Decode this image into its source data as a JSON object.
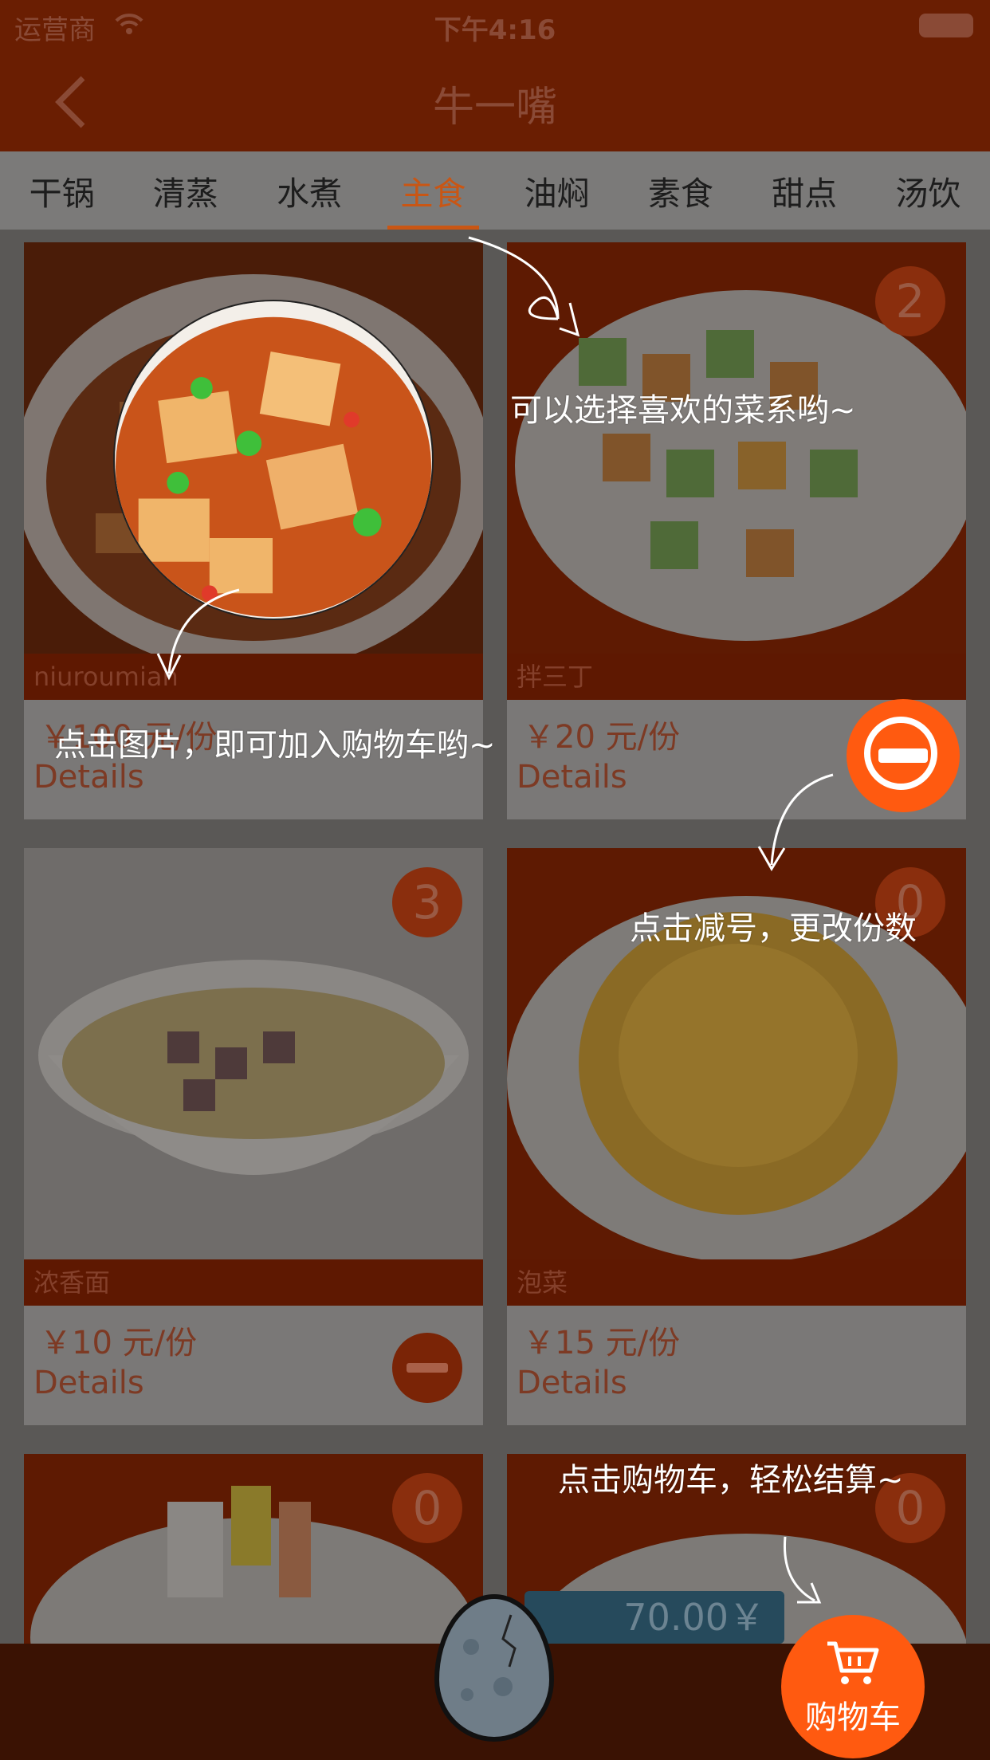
{
  "status_bar": {
    "carrier": "运营商",
    "time": "下午4:16"
  },
  "nav": {
    "title": "牛一嘴"
  },
  "tabs": [
    {
      "label": "干锅"
    },
    {
      "label": "清蒸"
    },
    {
      "label": "水煮"
    },
    {
      "label": "主食",
      "active": true
    },
    {
      "label": "油焖"
    },
    {
      "label": "素食"
    },
    {
      "label": "甜点"
    },
    {
      "label": "汤饮"
    }
  ],
  "dishes": [
    {
      "name": "niuroumian",
      "price": "￥100 元/份",
      "details": "Details"
    },
    {
      "name": "拌三丁",
      "price": "￥20 元/份",
      "details": "Details",
      "qty": "2"
    },
    {
      "name": "浓香面",
      "price": "￥10 元/份",
      "details": "Details",
      "qty": "3"
    },
    {
      "name": "泡菜",
      "price": "￥15 元/份",
      "details": "Details",
      "qty": "0"
    },
    {
      "qty": "0"
    },
    {
      "qty": "0"
    }
  ],
  "cart": {
    "total": "70.00￥",
    "label": "购物车"
  },
  "tips": {
    "category": "可以选择喜欢的菜系哟~",
    "picture": "点击图片，即可加入购物车哟~",
    "minus": "点击减号，更改份数",
    "cart": "点击购物车，轻松结算~"
  },
  "colors": {
    "accent": "#ff5a10",
    "topbar": "#6a1e02"
  }
}
